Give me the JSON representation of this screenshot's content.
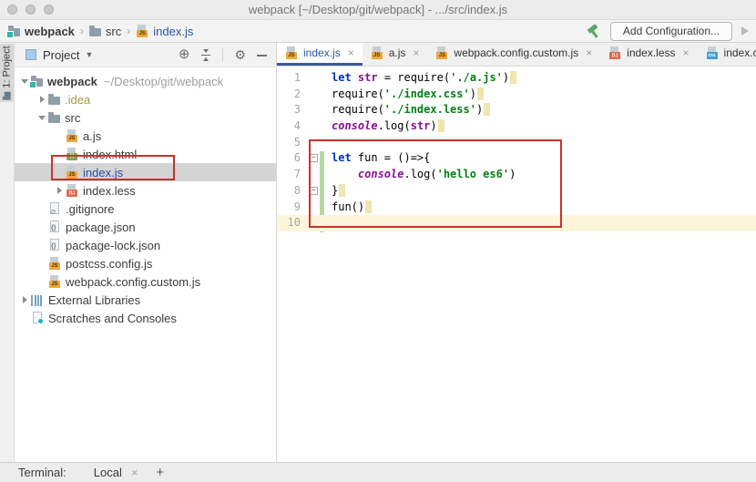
{
  "window": {
    "title": "webpack [~/Desktop/git/webpack] - .../src/index.js"
  },
  "toolbar": {
    "breadcrumbs": [
      {
        "label": "webpack",
        "icon": "folder-project",
        "bold": true
      },
      {
        "label": "src",
        "icon": "folder"
      },
      {
        "label": "index.js",
        "icon": "js",
        "current": true
      }
    ],
    "add_configuration_label": "Add Configuration..."
  },
  "tool_stripe": {
    "project_button_label": "1: Project"
  },
  "project_panel": {
    "header": {
      "title": "Project",
      "icons": [
        "locate-icon",
        "collapse-all-icon",
        "gear-icon",
        "hide-icon"
      ]
    },
    "tree": [
      {
        "label": "webpack",
        "icon": "folder-project",
        "arrow": "down",
        "level": 0,
        "bold": true,
        "suffix": "~/Desktop/git/webpack"
      },
      {
        "label": ".idea",
        "icon": "folder",
        "arrow": "right",
        "level": 1,
        "excluded": true
      },
      {
        "label": "src",
        "icon": "folder",
        "arrow": "down",
        "level": 1
      },
      {
        "label": "a.js",
        "icon": "js",
        "level": 2
      },
      {
        "label": "index.html",
        "icon": "html",
        "level": 2
      },
      {
        "label": "index.js",
        "icon": "js",
        "level": 2,
        "selected": true
      },
      {
        "label": "index.less",
        "icon": "less",
        "arrow": "right",
        "level": 2
      },
      {
        "label": ".gitignore",
        "icon": "gitignore",
        "level": 1
      },
      {
        "label": "package.json",
        "icon": "json",
        "level": 1
      },
      {
        "label": "package-lock.json",
        "icon": "json",
        "level": 1
      },
      {
        "label": "postcss.config.js",
        "icon": "js",
        "level": 1
      },
      {
        "label": "webpack.config.custom.js",
        "icon": "js",
        "level": 1
      },
      {
        "label": "External Libraries",
        "icon": "libs",
        "arrow": "right",
        "level": 0
      },
      {
        "label": "Scratches and Consoles",
        "icon": "scratches",
        "level": 0
      }
    ]
  },
  "editor": {
    "tabs": [
      {
        "label": "index.js",
        "icon": "js",
        "active": true,
        "close": "×"
      },
      {
        "label": "a.js",
        "icon": "js",
        "close": "×"
      },
      {
        "label": "webpack.config.custom.js",
        "icon": "js",
        "close": "×"
      },
      {
        "label": "index.less",
        "icon": "less",
        "close": "×"
      },
      {
        "label": "index.css",
        "icon": "css",
        "close": "×"
      }
    ],
    "lines": [
      {
        "num": "1",
        "tokens": [
          {
            "s": "kw",
            "t": "let"
          },
          {
            "s": "pl",
            "t": " "
          },
          {
            "s": "var",
            "t": "str"
          },
          {
            "s": "pl",
            "t": " = require("
          },
          {
            "s": "str",
            "t": "'./a.js'"
          },
          {
            "s": "pl",
            "t": ")"
          }
        ],
        "trail": true
      },
      {
        "num": "2",
        "tokens": [
          {
            "s": "pl",
            "t": "require("
          },
          {
            "s": "str",
            "t": "'./index.css'"
          },
          {
            "s": "pl",
            "t": ")"
          }
        ],
        "trail": true
      },
      {
        "num": "3",
        "tokens": [
          {
            "s": "pl",
            "t": "require("
          },
          {
            "s": "str",
            "t": "'./index.less'"
          },
          {
            "s": "pl",
            "t": ")"
          }
        ],
        "trail": true
      },
      {
        "num": "4",
        "tokens": [
          {
            "s": "glob",
            "t": "console"
          },
          {
            "s": "pl",
            "t": "."
          },
          {
            "s": "pl",
            "t": "log("
          },
          {
            "s": "var",
            "t": "str"
          },
          {
            "s": "pl",
            "t": ")"
          }
        ],
        "trail": true
      },
      {
        "num": "5",
        "tokens": []
      },
      {
        "num": "6",
        "tokens": [
          {
            "s": "kw",
            "t": "let"
          },
          {
            "s": "pl",
            "t": " fun = ()=>{"
          }
        ],
        "fold": true
      },
      {
        "num": "7",
        "tokens": [
          {
            "s": "pl",
            "t": "    "
          },
          {
            "s": "glob",
            "t": "console"
          },
          {
            "s": "pl",
            "t": ".log("
          },
          {
            "s": "str",
            "t": "'hello es6'"
          },
          {
            "s": "pl",
            "t": ")"
          }
        ]
      },
      {
        "num": "8",
        "tokens": [
          {
            "s": "pl",
            "t": "}"
          }
        ],
        "trail": true,
        "fold": true
      },
      {
        "num": "9",
        "tokens": [
          {
            "s": "pl",
            "t": "fun()"
          }
        ],
        "trail": true
      },
      {
        "num": "10",
        "tokens": [],
        "caret": true
      }
    ]
  },
  "terminal_bar": {
    "label": "Terminal:",
    "tab_label": "Local",
    "close": "×",
    "add": "+"
  },
  "colors": {
    "keyword": "#0033b3",
    "string": "#067d17",
    "global_identifier": "#871094",
    "annotation_red": "#c5352b",
    "tree_selection_bg": "#d4d4d4",
    "caret_line_bg": "#fcf5da",
    "trailing_warning_bg": "#efe5ad",
    "added_lines_gutter": "#b7d8a6",
    "active_tab_underline": "#3b5a9b",
    "active_file_blue": "#2857a4",
    "hammer_green": "#59a869"
  }
}
